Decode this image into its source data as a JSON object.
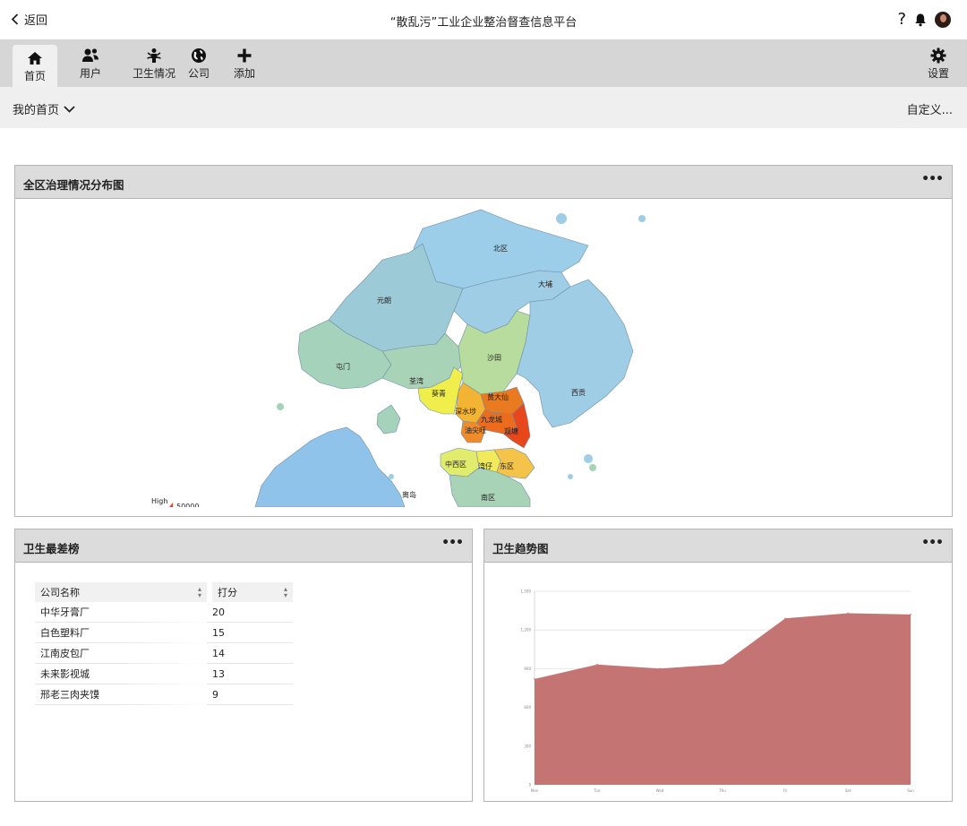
{
  "header": {
    "back_label": "返回",
    "title": "“散乱污”工业企业整治督查信息平台",
    "help_label": "?"
  },
  "toolbar": {
    "items": [
      {
        "label": "首页",
        "icon": "home-icon",
        "active": true
      },
      {
        "label": "用户",
        "icon": "users-icon"
      },
      {
        "label": "卫生情况",
        "icon": "hygiene-icon"
      },
      {
        "label": "公司",
        "icon": "globe-icon"
      },
      {
        "label": "添加",
        "icon": "plus-icon"
      }
    ],
    "settings_label": "设置"
  },
  "subbar": {
    "my_home": "我的首页",
    "customize": "自定义..."
  },
  "map_panel": {
    "title": "全区治理情况分布图",
    "menu": "•••",
    "legend_high": "High",
    "legend_value": "50000",
    "regions": [
      "北区",
      "大埔",
      "元朗",
      "屯门",
      "沙田",
      "荃湾",
      "葵青",
      "黄大仙",
      "深水埗",
      "九龙城",
      "油尖旺",
      "观塘",
      "西贡",
      "中西区",
      "湾仔",
      "东区",
      "离岛",
      "南区"
    ]
  },
  "rank_panel": {
    "title": "卫生最差榜",
    "menu": "•••",
    "columns": [
      "公司名称",
      "打分"
    ],
    "rows": [
      [
        "中华牙膏厂",
        "20"
      ],
      [
        "白色塑料厂",
        "15"
      ],
      [
        "江南皮包厂",
        "14"
      ],
      [
        "未来影视城",
        "13"
      ],
      [
        "邢老三肉夹馍",
        "9"
      ]
    ]
  },
  "trend_panel": {
    "title": "卫生趋势图",
    "menu": "•••",
    "series_color": "#c47573"
  },
  "chart_data": {
    "type": "area",
    "title": "卫生趋势图",
    "categories": [
      "Mon",
      "Tue",
      "Wed",
      "Thu",
      "Fri",
      "Sat",
      "Sun"
    ],
    "values": [
      820,
      932,
      901,
      934,
      1290,
      1330,
      1320
    ],
    "y_ticks": [
      "0",
      "300",
      "600",
      "900",
      "1,200",
      "1,500"
    ],
    "ylim": [
      0,
      1500
    ],
    "grid": true,
    "color": "#c47573"
  }
}
